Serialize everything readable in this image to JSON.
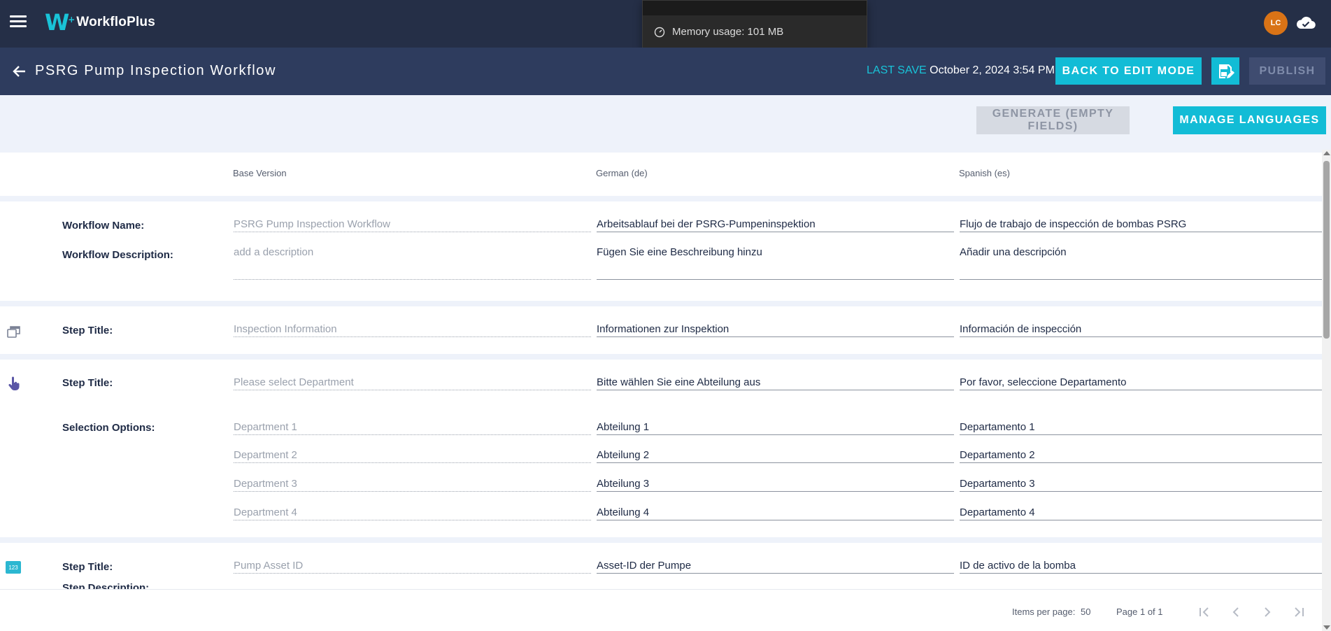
{
  "app": {
    "name": "WorkfloPlus",
    "logo_mark": "W"
  },
  "user": {
    "initials": "LC"
  },
  "memory": {
    "text": "Memory usage: 101 MB"
  },
  "header": {
    "title": "PSRG Pump Inspection Workflow",
    "last_save_label": "LAST SAVE",
    "last_save_value": "October 2, 2024 3:54 PM",
    "back_to_edit": "BACK TO EDIT MODE",
    "publish": "PUBLISH"
  },
  "toolbar": {
    "generate": "GENERATE (EMPTY FIELDS)",
    "manage_languages": "MANAGE LANGUAGES"
  },
  "columns": {
    "base": "Base Version",
    "de": "German (de)",
    "es": "Spanish (es)"
  },
  "rows": {
    "workflow_name": {
      "label": "Workflow Name:",
      "base": "PSRG Pump Inspection Workflow",
      "de": "Arbeitsablauf bei der PSRG-Pumpeninspektion",
      "es": "Flujo de trabajo de inspección de bombas PSRG"
    },
    "workflow_desc": {
      "label": "Workflow Description:",
      "base": "add a description",
      "de": "Fügen Sie eine Beschreibung hinzu",
      "es": "Añadir una descripción"
    },
    "step1": {
      "label": "Step Title:",
      "base": "Inspection Information",
      "de": "Informationen zur Inspektion",
      "es": "Información de inspección"
    },
    "step2": {
      "label": "Step Title:",
      "base": "Please select Department",
      "de": "Bitte wählen Sie eine Abteilung aus",
      "es": "Por favor, seleccione Departamento"
    },
    "options_label": "Selection Options:",
    "options": [
      {
        "base": "Department 1",
        "de": "Abteilung 1",
        "es": "Departamento 1"
      },
      {
        "base": "Department 2",
        "de": "Abteilung 2",
        "es": "Departamento 2"
      },
      {
        "base": "Department 3",
        "de": "Abteilung 3",
        "es": "Departamento 3"
      },
      {
        "base": "Department 4",
        "de": "Abteilung 4",
        "es": "Departamento 4"
      }
    ],
    "step3": {
      "label": "Step Title:",
      "icon_text": "123",
      "base": "Pump Asset ID",
      "de": "Asset-ID der Pumpe",
      "es": "ID de activo de la bomba"
    },
    "step3_desc_label": "Step Description:"
  },
  "pager": {
    "items_label": "Items per page:",
    "items_value": "50",
    "page_text": "Page 1 of 1"
  },
  "icons": {
    "menu": "hamburger-icon",
    "cloud": "cloud-check-icon",
    "back": "arrow-left-icon",
    "save": "save-edit-icon",
    "gauge": "gauge-icon",
    "step_info": "multi-window-icon",
    "step_select": "touch-hand-icon",
    "step_number": "number-field-icon"
  },
  "colors": {
    "accent": "#12bcd6",
    "topbar": "#252f47",
    "subheader": "#2e3c5e",
    "avatar": "#d97316"
  }
}
